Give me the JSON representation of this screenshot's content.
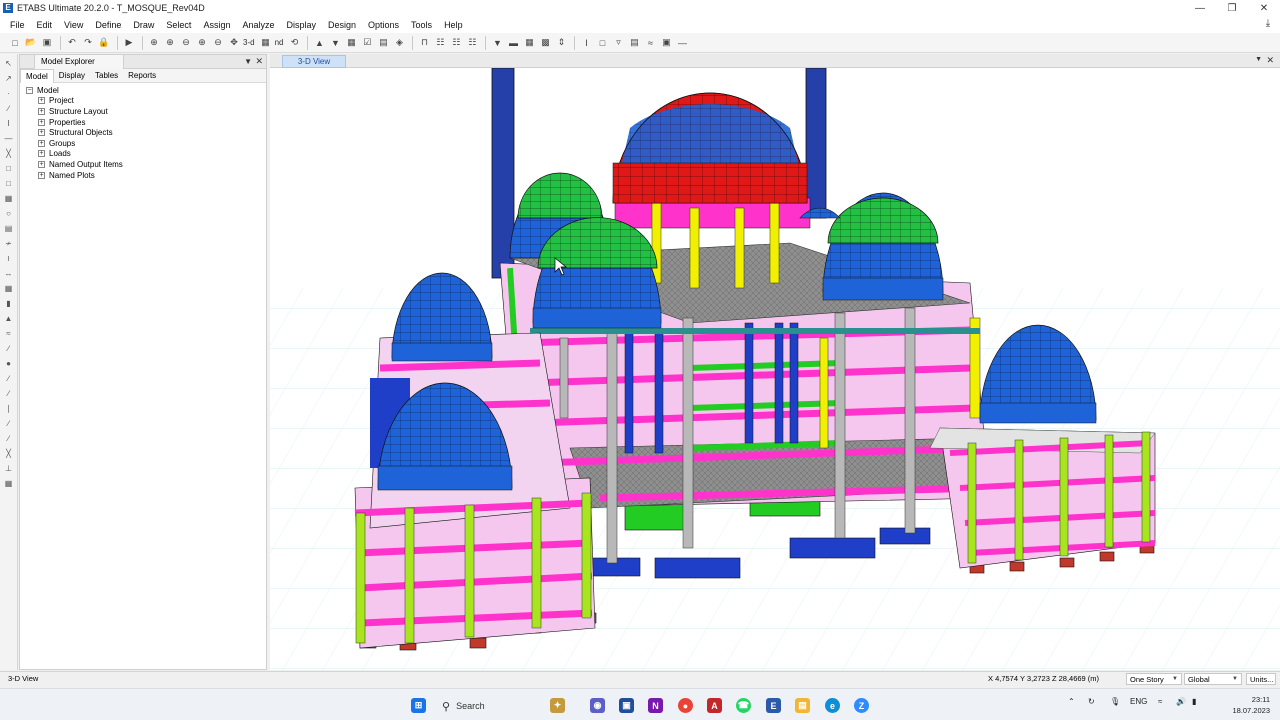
{
  "window": {
    "title": "ETABS Ultimate 20.2.0 - T_MOSQUE_Rev04D",
    "logo_letter": "E",
    "controls": {
      "minimize": "—",
      "restore": "❐",
      "close": "✕"
    }
  },
  "menu": {
    "items": [
      "File",
      "Edit",
      "View",
      "Define",
      "Draw",
      "Select",
      "Assign",
      "Analyze",
      "Display",
      "Design",
      "Options",
      "Tools",
      "Help"
    ]
  },
  "toolbar": {
    "view_label": "3-d",
    "plan_label": "nd"
  },
  "explorer": {
    "title": "Model Explorer",
    "tabs": [
      "Model",
      "Display",
      "Tables",
      "Reports"
    ],
    "root": "Model",
    "nodes": [
      "Project",
      "Structure Layout",
      "Properties",
      "Structural Objects",
      "Groups",
      "Loads",
      "Named Output Items",
      "Named Plots"
    ]
  },
  "view": {
    "tab_label": "3-D View"
  },
  "status": {
    "left": "3-D View",
    "coords": "X 4,7574  Y 3,2723  Z 28,4669 (m)",
    "story_select": "One Story",
    "coord_system": "Global",
    "units": "Units..."
  },
  "taskbar": {
    "search_label": "Search",
    "lang": "ENG",
    "time": "23:11",
    "date": "18.07.2023"
  },
  "colors": {
    "magenta_beam": "#ff33cc",
    "yellow_column": "#f0f000",
    "green_beam": "#22cc22",
    "dome_blue": "#1f63d8",
    "dome_green": "#23c043",
    "dome_red": "#e01818",
    "minaret": "#2540a8",
    "slab_gray": "#9a9a9a",
    "accent": "#1a5fb4"
  }
}
